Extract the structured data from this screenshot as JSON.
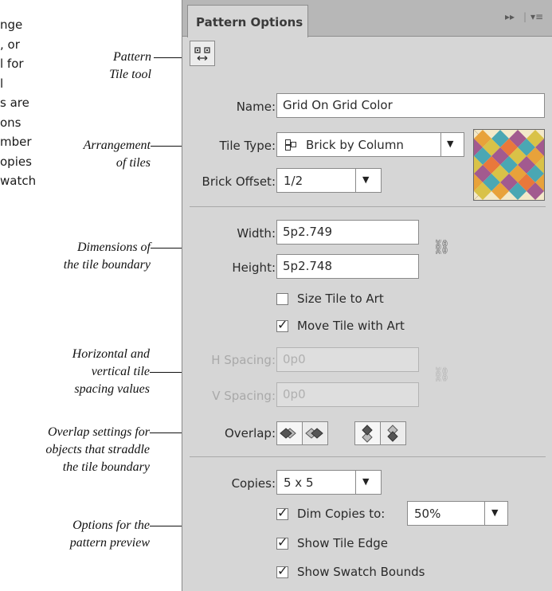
{
  "body_text": [
    "nge",
    ", or",
    "l for",
    "l",
    "s are",
    "ons",
    "mber",
    "opies",
    "watch"
  ],
  "callouts": {
    "pattern_tile_tool": [
      "Pattern",
      "Tile tool"
    ],
    "arrangement": [
      "Arrangement",
      "of tiles"
    ],
    "dimensions": [
      "Dimensions of",
      "the tile boundary"
    ],
    "spacing": [
      "Horizontal and",
      "vertical tile",
      "spacing values"
    ],
    "overlap": [
      "Overlap settings for",
      "objects that straddle",
      "the tile boundary"
    ],
    "preview": [
      "Options for the",
      "pattern preview"
    ]
  },
  "panel": {
    "tab_title": "Pattern Options",
    "top_controls": {
      "collapse": "▸▸",
      "menu": "▾≡"
    },
    "name": {
      "label": "Name:",
      "value": "Grid On Grid Color"
    },
    "tile_type": {
      "label": "Tile Type:",
      "icon": "brick-column-icon",
      "value": "Brick by Column"
    },
    "brick_offset": {
      "label": "Brick Offset:",
      "value": "1/2"
    },
    "width": {
      "label": "Width:",
      "value": "5p2.749"
    },
    "height": {
      "label": "Height:",
      "value": "5p2.748"
    },
    "size_tile_to_art": {
      "label": "Size Tile to Art",
      "checked": false
    },
    "move_tile_with_art": {
      "label": "Move Tile with Art",
      "checked": true
    },
    "h_spacing": {
      "label": "H Spacing:",
      "value": "0p0"
    },
    "v_spacing": {
      "label": "V Spacing:",
      "value": "0p0"
    },
    "overlap": {
      "label": "Overlap:"
    },
    "copies": {
      "label": "Copies:",
      "value": "5 x 5"
    },
    "dim_copies": {
      "label": "Dim Copies to:",
      "checked": true,
      "value": "50%"
    },
    "show_tile_edge": {
      "label": "Show Tile Edge",
      "checked": true
    },
    "show_swatch_bounds": {
      "label": "Show Swatch Bounds",
      "checked": true
    }
  },
  "colors": {
    "panel_bg": "#d6d6d6",
    "preview_colors": [
      "#e8a23a",
      "#4aa7b3",
      "#a25a8f",
      "#d9c247",
      "#e9783b"
    ]
  }
}
